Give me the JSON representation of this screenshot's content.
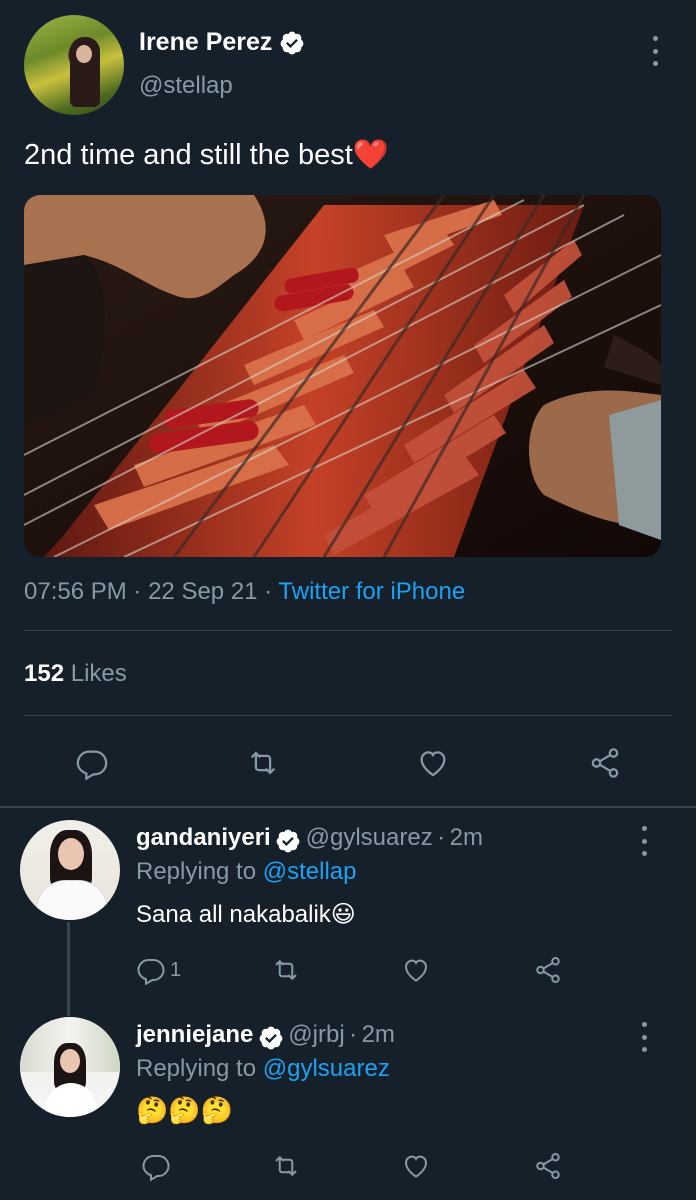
{
  "tweet": {
    "author_name": "Irene Perez",
    "author_handle": "@stellap",
    "text": "2nd time and still the best❤️",
    "time": "07:56 PM",
    "date": "22 Sep 21",
    "separator": "·",
    "source": "Twitter for iPhone",
    "likes_count": "152",
    "likes_label": "Likes"
  },
  "replies": [
    {
      "name": "gandaniyeri",
      "handle": "@gylsuarez",
      "age": "2m",
      "replying_prefix": "Replying to",
      "replying_to": "@stellap",
      "text": "Sana all nakabalik😃",
      "reply_count": "1"
    },
    {
      "name": "jenniejane",
      "handle": "@jrbj",
      "age": "2m",
      "replying_prefix": "Replying to",
      "replying_to": "@gylsuarez",
      "text": "🤔🤔🤔",
      "reply_count": ""
    }
  ],
  "icons": {
    "verified": "verified-badge-icon",
    "menu": "more-vertical-icon",
    "reply": "reply-icon",
    "retweet": "retweet-icon",
    "like": "heart-icon",
    "share": "share-icon"
  },
  "colors": {
    "background": "#15202b",
    "muted": "#8899a6",
    "accent": "#1da1f2",
    "divider": "#38444d"
  }
}
